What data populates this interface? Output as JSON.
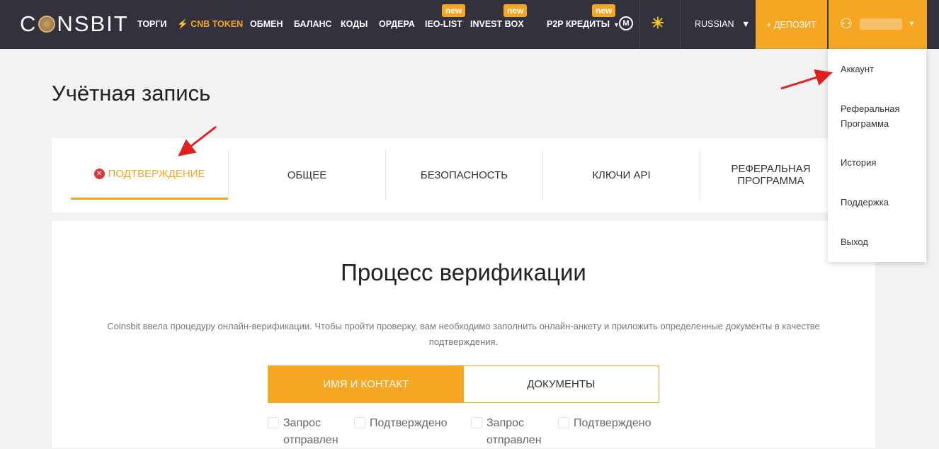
{
  "nav": {
    "logo": "CONSBIT",
    "items": [
      "ТОРГИ",
      "CNB TOKEN",
      "ОБМЕН",
      "БАЛАНС",
      "КОДЫ",
      "ОРДЕРА",
      "IEO-LIST",
      "INVEST BOX",
      "P2P КРЕДИТЫ"
    ],
    "badge": "new",
    "language": "RUSSIAN",
    "deposit": "+ ДЕПОЗИТ",
    "accent": "#f5a623"
  },
  "page": {
    "title": "Учётная запись"
  },
  "tabs": [
    "ПОДТВЕРЖДЕНИЕ",
    "ОБЩЕЕ",
    "БЕЗОПАСНОСТЬ",
    "КЛЮЧИ API",
    "РЕФЕРАЛЬНАЯ ПРОГРАММА"
  ],
  "verification": {
    "title": "Процесс верификации",
    "description": "Coinsbit ввела процедуру онлайн-верификации. Чтобы пройти проверку, вам необходимо заполнить онлайн-анкету и приложить определенные документы в качестве подтверждения.",
    "segments": [
      "ИМЯ И КОНТАКТ",
      "ДОКУМЕНТЫ"
    ],
    "checks": [
      "Запрос отправлен",
      "Подтверждено",
      "Запрос отправлен",
      "Подтверждено"
    ]
  },
  "menu": [
    "Аккаунт",
    "Реферальная Программа",
    "История",
    "Поддержка",
    "Выход"
  ]
}
